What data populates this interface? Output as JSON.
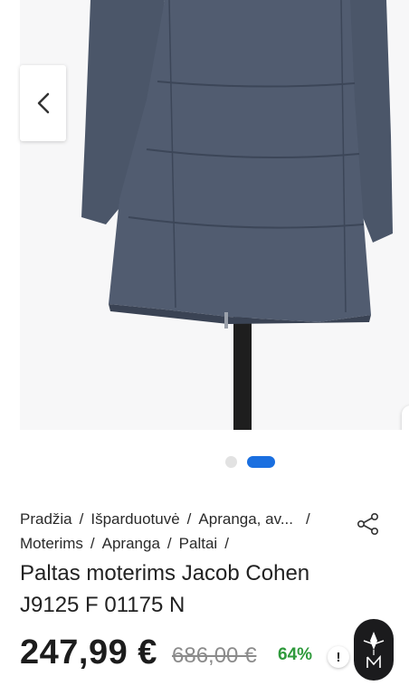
{
  "gallery": {
    "image_alt": "Paltas moterims Jacob Cohen J9125 F 01175 N",
    "coat_color": "#4b5669",
    "stand_color": "#1e1e1e",
    "active_slide": 2,
    "slide_count": 2
  },
  "breadcrumb": [
    {
      "label": "Pradžia"
    },
    {
      "label": "Išparduotuvė"
    },
    {
      "label": "Apranga, av..."
    },
    {
      "label": "Moterims"
    },
    {
      "label": "Apranga"
    },
    {
      "label": "Paltai"
    }
  ],
  "product": {
    "title": "Paltas moterims Jacob Cohen J9125 F 01175 N",
    "price": "247,99 €",
    "old_price": "686,00 €",
    "discount": "64%",
    "info_symbol": "!"
  },
  "colors": {
    "accent": "#1a6fe0",
    "discount": "#2f9a3c",
    "badge_bg": "#1b1b1d"
  },
  "icons": {
    "prev": "chevron-left-icon",
    "share": "share-icon",
    "logo": "brand-logo"
  }
}
